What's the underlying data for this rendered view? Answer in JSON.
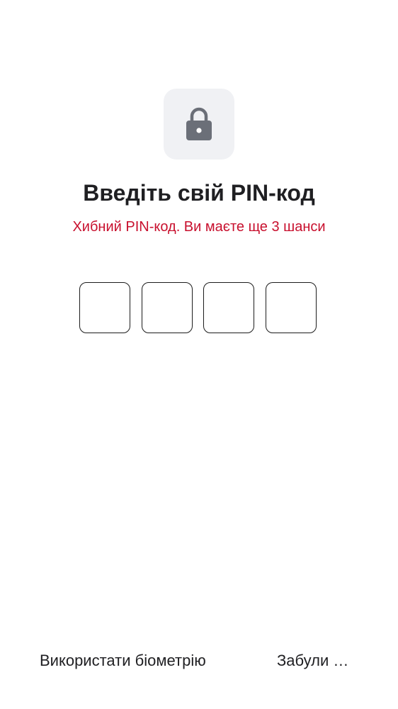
{
  "lock": {
    "icon": "lock-icon"
  },
  "header": {
    "title": "Введіть свій PIN-код",
    "error": "Хибний PIN-код. Ви маєте ще 3 шанси"
  },
  "pin": {
    "length": 4,
    "digits": [
      "",
      "",
      "",
      ""
    ]
  },
  "footer": {
    "biometric_label": "Використати біометрію",
    "forgot_label": "Забули …"
  },
  "colors": {
    "error": "#c8102e",
    "text": "#1f1f22",
    "tile_bg": "#f0f1f4",
    "icon": "#6b6f78"
  }
}
